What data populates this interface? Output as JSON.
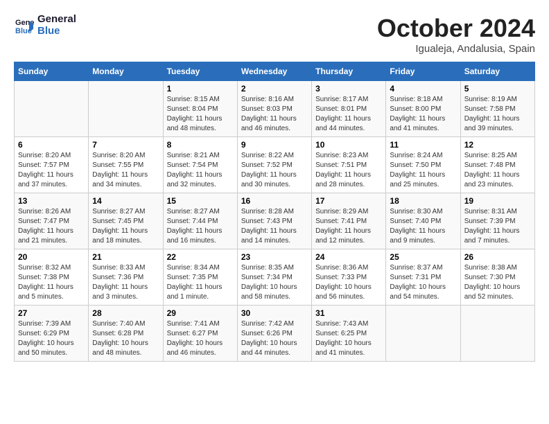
{
  "header": {
    "logo_line1": "General",
    "logo_line2": "Blue",
    "month": "October 2024",
    "location": "Igualeja, Andalusia, Spain"
  },
  "weekdays": [
    "Sunday",
    "Monday",
    "Tuesday",
    "Wednesday",
    "Thursday",
    "Friday",
    "Saturday"
  ],
  "weeks": [
    [
      {
        "day": "",
        "info": ""
      },
      {
        "day": "",
        "info": ""
      },
      {
        "day": "1",
        "info": "Sunrise: 8:15 AM\nSunset: 8:04 PM\nDaylight: 11 hours and 48 minutes."
      },
      {
        "day": "2",
        "info": "Sunrise: 8:16 AM\nSunset: 8:03 PM\nDaylight: 11 hours and 46 minutes."
      },
      {
        "day": "3",
        "info": "Sunrise: 8:17 AM\nSunset: 8:01 PM\nDaylight: 11 hours and 44 minutes."
      },
      {
        "day": "4",
        "info": "Sunrise: 8:18 AM\nSunset: 8:00 PM\nDaylight: 11 hours and 41 minutes."
      },
      {
        "day": "5",
        "info": "Sunrise: 8:19 AM\nSunset: 7:58 PM\nDaylight: 11 hours and 39 minutes."
      }
    ],
    [
      {
        "day": "6",
        "info": "Sunrise: 8:20 AM\nSunset: 7:57 PM\nDaylight: 11 hours and 37 minutes."
      },
      {
        "day": "7",
        "info": "Sunrise: 8:20 AM\nSunset: 7:55 PM\nDaylight: 11 hours and 34 minutes."
      },
      {
        "day": "8",
        "info": "Sunrise: 8:21 AM\nSunset: 7:54 PM\nDaylight: 11 hours and 32 minutes."
      },
      {
        "day": "9",
        "info": "Sunrise: 8:22 AM\nSunset: 7:52 PM\nDaylight: 11 hours and 30 minutes."
      },
      {
        "day": "10",
        "info": "Sunrise: 8:23 AM\nSunset: 7:51 PM\nDaylight: 11 hours and 28 minutes."
      },
      {
        "day": "11",
        "info": "Sunrise: 8:24 AM\nSunset: 7:50 PM\nDaylight: 11 hours and 25 minutes."
      },
      {
        "day": "12",
        "info": "Sunrise: 8:25 AM\nSunset: 7:48 PM\nDaylight: 11 hours and 23 minutes."
      }
    ],
    [
      {
        "day": "13",
        "info": "Sunrise: 8:26 AM\nSunset: 7:47 PM\nDaylight: 11 hours and 21 minutes."
      },
      {
        "day": "14",
        "info": "Sunrise: 8:27 AM\nSunset: 7:45 PM\nDaylight: 11 hours and 18 minutes."
      },
      {
        "day": "15",
        "info": "Sunrise: 8:27 AM\nSunset: 7:44 PM\nDaylight: 11 hours and 16 minutes."
      },
      {
        "day": "16",
        "info": "Sunrise: 8:28 AM\nSunset: 7:43 PM\nDaylight: 11 hours and 14 minutes."
      },
      {
        "day": "17",
        "info": "Sunrise: 8:29 AM\nSunset: 7:41 PM\nDaylight: 11 hours and 12 minutes."
      },
      {
        "day": "18",
        "info": "Sunrise: 8:30 AM\nSunset: 7:40 PM\nDaylight: 11 hours and 9 minutes."
      },
      {
        "day": "19",
        "info": "Sunrise: 8:31 AM\nSunset: 7:39 PM\nDaylight: 11 hours and 7 minutes."
      }
    ],
    [
      {
        "day": "20",
        "info": "Sunrise: 8:32 AM\nSunset: 7:38 PM\nDaylight: 11 hours and 5 minutes."
      },
      {
        "day": "21",
        "info": "Sunrise: 8:33 AM\nSunset: 7:36 PM\nDaylight: 11 hours and 3 minutes."
      },
      {
        "day": "22",
        "info": "Sunrise: 8:34 AM\nSunset: 7:35 PM\nDaylight: 11 hours and 1 minute."
      },
      {
        "day": "23",
        "info": "Sunrise: 8:35 AM\nSunset: 7:34 PM\nDaylight: 10 hours and 58 minutes."
      },
      {
        "day": "24",
        "info": "Sunrise: 8:36 AM\nSunset: 7:33 PM\nDaylight: 10 hours and 56 minutes."
      },
      {
        "day": "25",
        "info": "Sunrise: 8:37 AM\nSunset: 7:31 PM\nDaylight: 10 hours and 54 minutes."
      },
      {
        "day": "26",
        "info": "Sunrise: 8:38 AM\nSunset: 7:30 PM\nDaylight: 10 hours and 52 minutes."
      }
    ],
    [
      {
        "day": "27",
        "info": "Sunrise: 7:39 AM\nSunset: 6:29 PM\nDaylight: 10 hours and 50 minutes."
      },
      {
        "day": "28",
        "info": "Sunrise: 7:40 AM\nSunset: 6:28 PM\nDaylight: 10 hours and 48 minutes."
      },
      {
        "day": "29",
        "info": "Sunrise: 7:41 AM\nSunset: 6:27 PM\nDaylight: 10 hours and 46 minutes."
      },
      {
        "day": "30",
        "info": "Sunrise: 7:42 AM\nSunset: 6:26 PM\nDaylight: 10 hours and 44 minutes."
      },
      {
        "day": "31",
        "info": "Sunrise: 7:43 AM\nSunset: 6:25 PM\nDaylight: 10 hours and 41 minutes."
      },
      {
        "day": "",
        "info": ""
      },
      {
        "day": "",
        "info": ""
      }
    ]
  ]
}
